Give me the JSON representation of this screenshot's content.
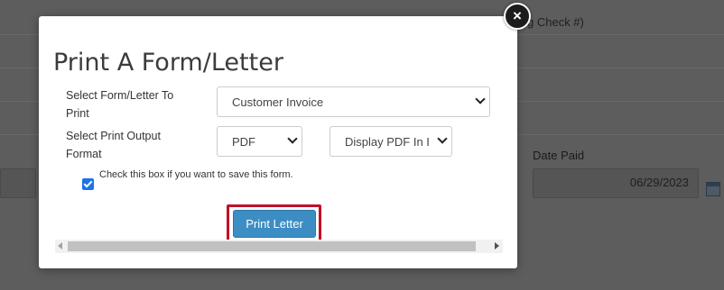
{
  "background": {
    "header_text": "g Check #)",
    "date_paid_label": "Date Paid",
    "date_paid_value": "06/29/2023"
  },
  "modal": {
    "close_label": "×",
    "title": "Print A Form/Letter",
    "form_label_line1": "Select Form/Letter To",
    "form_label_line2": "Print",
    "form_select_value": "Customer Invoice",
    "format_label_line1": "Select Print Output",
    "format_label_line2": "Format",
    "format_select_value": "PDF",
    "display_select_value": "Display PDF In I",
    "save_checkbox_checked": true,
    "save_checkbox_label": "Check this box if you want to save this form.",
    "print_button_label": "Print Letter",
    "accent_color": "#3c8dc4",
    "highlight_color": "#c0102a"
  }
}
